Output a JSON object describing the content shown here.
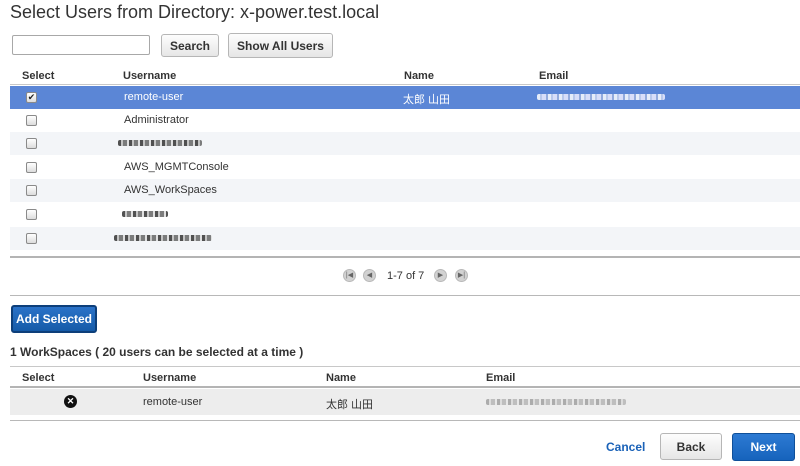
{
  "header": {
    "title": "Select Users from Directory: x-power.test.local"
  },
  "search": {
    "value": "",
    "placeholder": "",
    "search_label": "Search",
    "show_all_label": "Show All Users"
  },
  "directory_table": {
    "columns": [
      "Select",
      "Username",
      "Name",
      "Email"
    ],
    "rows": [
      {
        "checked": true,
        "username": "remote-user",
        "name": "太郎 山田",
        "email_redacted": true,
        "selected": true
      },
      {
        "checked": false,
        "username": "Administrator",
        "name": "",
        "email_redacted": false,
        "selected": false
      },
      {
        "checked": false,
        "username": "",
        "name": "",
        "email_redacted": false,
        "username_redacted": true
      },
      {
        "checked": false,
        "username": "AWS_MGMTConsole",
        "name": "",
        "email_redacted": false
      },
      {
        "checked": false,
        "username": "AWS_WorkSpaces",
        "name": "",
        "email_redacted": false
      },
      {
        "checked": false,
        "username": "",
        "name": "",
        "email_redacted": false,
        "username_redacted": true
      },
      {
        "checked": false,
        "username": "",
        "name": "",
        "email_redacted": false,
        "username_redacted": true
      }
    ]
  },
  "pager": {
    "text": "1-7 of 7"
  },
  "actions": {
    "add_selected_label": "Add Selected"
  },
  "workspaces": {
    "title": "1 WorkSpaces ( 20 users can be selected at a time )",
    "columns": [
      "Select",
      "Username",
      "Name",
      "Email"
    ],
    "rows": [
      {
        "username": "remote-user",
        "name": "太郎 山田",
        "email_redacted": true
      }
    ]
  },
  "footer": {
    "cancel_label": "Cancel",
    "back_label": "Back",
    "next_label": "Next"
  },
  "colors": {
    "selected_row": "#5b86d6",
    "primary_button": "#1663bc",
    "link": "#1a62b8"
  },
  "icons": {
    "checkmark": "check-icon",
    "remove": "remove-icon",
    "pager_first": "first-page-icon",
    "pager_prev": "prev-page-icon",
    "pager_next": "next-page-icon",
    "pager_last": "last-page-icon"
  }
}
